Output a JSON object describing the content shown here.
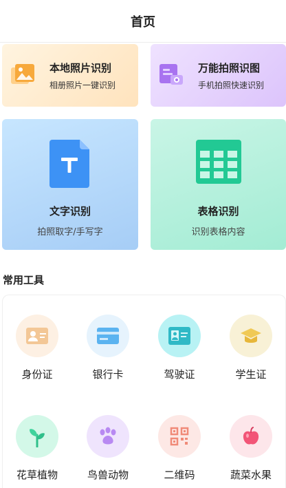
{
  "header": {
    "title": "首页"
  },
  "feature_cards": {
    "local_photo": {
      "title": "本地照片识别",
      "subtitle": "相册照片一键识别",
      "icon": "photo-album-icon"
    },
    "photo_capture": {
      "title": "万能拍照识图",
      "subtitle": "手机拍照快速识别",
      "icon": "camera-document-icon"
    },
    "text_ocr": {
      "title": "文字识别",
      "subtitle": "拍照取字/手写字",
      "icon": "text-document-icon"
    },
    "table_ocr": {
      "title": "表格识别",
      "subtitle": "识别表格内容",
      "icon": "table-grid-icon"
    }
  },
  "tools": {
    "section_title": "常用工具",
    "items": [
      {
        "label": "身份证",
        "icon": "id-card-icon"
      },
      {
        "label": "银行卡",
        "icon": "bank-card-icon"
      },
      {
        "label": "驾驶证",
        "icon": "driver-license-icon"
      },
      {
        "label": "学生证",
        "icon": "graduation-cap-icon"
      },
      {
        "label": "花草植物",
        "icon": "plant-sprout-icon"
      },
      {
        "label": "鸟兽动物",
        "icon": "paw-icon"
      },
      {
        "label": "二维码",
        "icon": "qr-code-icon"
      },
      {
        "label": "蔬菜水果",
        "icon": "apple-icon"
      }
    ]
  },
  "colors": {
    "local_photo_bg": "#ffe8c8",
    "photo_capture_bg": "#e4cffd",
    "text_ocr_bg": "#b6d9fb",
    "table_ocr_bg": "#b4f0dc",
    "text_icon": "#3d92f5",
    "table_icon": "#22c994"
  }
}
